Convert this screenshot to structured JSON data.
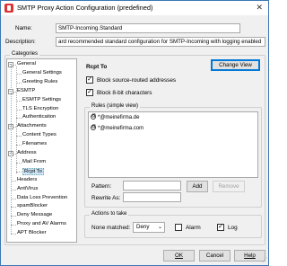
{
  "window": {
    "title": "SMTP Proxy Action Configuration (predefined)",
    "icon": "firebox-policy-icon"
  },
  "form": {
    "name_label": "Name:",
    "name_value": "SMTP-Incoming.Standard",
    "description_label": "Description:",
    "description_value": "ard recommended standard configuration for SMTP-Incoming with logging enabled"
  },
  "categories": {
    "legend": "Categories",
    "items": [
      {
        "label": "General",
        "level": 0,
        "expander": "−"
      },
      {
        "label": "General Settings",
        "level": 1
      },
      {
        "label": "Greeting Rules",
        "level": 1
      },
      {
        "label": "ESMTP",
        "level": 0,
        "expander": "−"
      },
      {
        "label": "ESMTP Settings",
        "level": 1
      },
      {
        "label": "TLS Encryption",
        "level": 1
      },
      {
        "label": "Authentication",
        "level": 1
      },
      {
        "label": "Attachments",
        "level": 0,
        "expander": "−"
      },
      {
        "label": "Content Types",
        "level": 1
      },
      {
        "label": "Filenames",
        "level": 1
      },
      {
        "label": "Address",
        "level": 0,
        "expander": "−"
      },
      {
        "label": "Mail From",
        "level": 1
      },
      {
        "label": "Rcpt To",
        "level": 1,
        "selected": true
      },
      {
        "label": "Headers",
        "level": 0
      },
      {
        "label": "AntiVirus",
        "level": 0
      },
      {
        "label": "Data Loss Prevention",
        "level": 0
      },
      {
        "label": "spamBlocker",
        "level": 0
      },
      {
        "label": "Deny Message",
        "level": 0
      },
      {
        "label": "Proxy and AV Alarms",
        "level": 0
      },
      {
        "label": "APT Blocker",
        "level": 0
      }
    ]
  },
  "panel": {
    "heading": "Rcpt To",
    "change_view_label": "Change View",
    "block_source_routed_label": "Block source-routed addresses",
    "block_source_routed_checked": true,
    "block_8bit_label": "Block 8-bit characters",
    "block_8bit_checked": true,
    "rules_legend": "Rules (simple view)",
    "rules": [
      "*@meinefirma.de",
      "*@meinefirma.com"
    ],
    "pattern_label": "Pattern:",
    "pattern_value": "",
    "add_label": "Add",
    "remove_label": "Remove",
    "rewrite_label": "Rewrite As:",
    "rewrite_value": "",
    "actions_legend": "Actions to take",
    "none_matched_label": "None matched:",
    "none_matched_value": "Deny",
    "alarm_label": "Alarm",
    "alarm_checked": false,
    "log_label": "Log",
    "log_checked": true
  },
  "footer": {
    "ok_label": "OK",
    "cancel_label": "Cancel",
    "help_label": "Help"
  }
}
